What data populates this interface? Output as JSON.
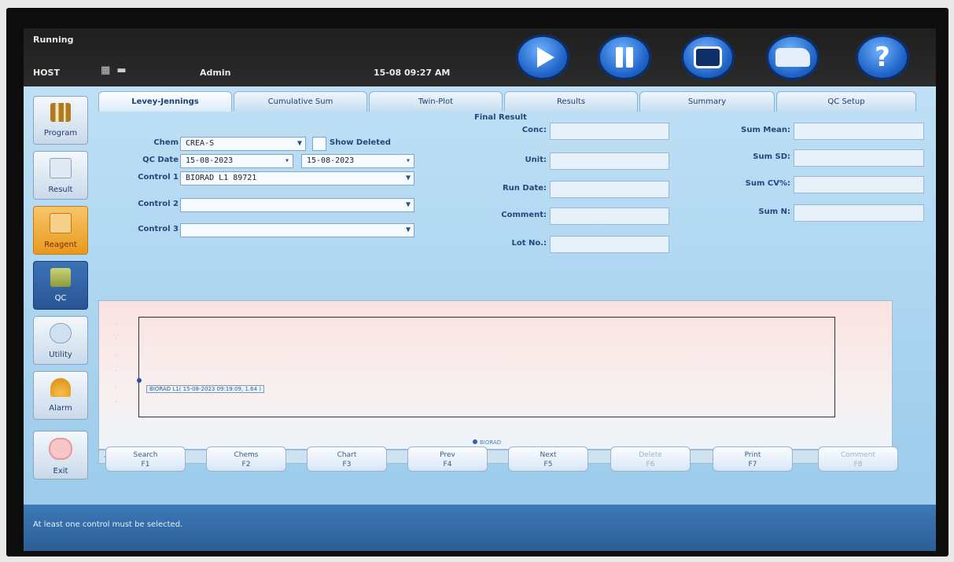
{
  "status": {
    "running": "Running",
    "host": "HOST",
    "user": "Admin",
    "datetime": "15-08 09:27 AM"
  },
  "controls": [
    {
      "name": "run-button",
      "icon": "play-icon"
    },
    {
      "name": "pause-button",
      "icon": "pause-icon"
    },
    {
      "name": "stop-button",
      "icon": "stop-icon"
    },
    {
      "name": "transport-button",
      "icon": "truck-icon"
    },
    {
      "name": "help-button",
      "icon": "help-icon",
      "label": "?"
    }
  ],
  "sidebar": {
    "items": [
      {
        "label": "Program"
      },
      {
        "label": "Result"
      },
      {
        "label": "Reagent"
      },
      {
        "label": "QC"
      },
      {
        "label": "Utility"
      },
      {
        "label": "Alarm"
      },
      {
        "label": "Exit"
      }
    ]
  },
  "tabs": [
    "Levey-Jennings",
    "Cumulative Sum",
    "Twin-Plot",
    "Results",
    "Summary",
    "QC Setup"
  ],
  "filters": {
    "chem_label": "Chem",
    "chem_value": "CREA-S",
    "show_deleted": "Show Deleted",
    "qc_date_label": "QC Date",
    "date_from": "15-08-2023",
    "date_to": "15-08-2023",
    "control1_label": "Control 1",
    "control1_value": "BIORAD L1 89721",
    "control2_label": "Control 2",
    "control2_value": "",
    "control3_label": "Control 3",
    "control3_value": ""
  },
  "final_result": {
    "title": "Final Result",
    "conc": "Conc:",
    "unit": "Unit:",
    "run_date": "Run Date:",
    "comment": "Comment:",
    "lot_no": "Lot No.:"
  },
  "summary_fields": {
    "mean": "Sum Mean:",
    "sd": "Sum SD:",
    "cv": "Sum CV%:",
    "n": "Sum N:"
  },
  "chart": {
    "point_label": "BIORAD L1( 15-08-2023 09:19:09, 1.64 )",
    "legend": "BIORAD"
  },
  "function_keys": [
    {
      "label": "Search",
      "key": "F1",
      "enabled": true
    },
    {
      "label": "Chems",
      "key": "F2",
      "enabled": true
    },
    {
      "label": "Chart",
      "key": "F3",
      "enabled": true
    },
    {
      "label": "Prev",
      "key": "F4",
      "enabled": true
    },
    {
      "label": "Next",
      "key": "F5",
      "enabled": true
    },
    {
      "label": "Delete",
      "key": "F6",
      "enabled": false
    },
    {
      "label": "Print",
      "key": "F7",
      "enabled": true
    },
    {
      "label": "Comment",
      "key": "F8",
      "enabled": false
    }
  ],
  "footer": {
    "message": "At least one control must be selected."
  }
}
